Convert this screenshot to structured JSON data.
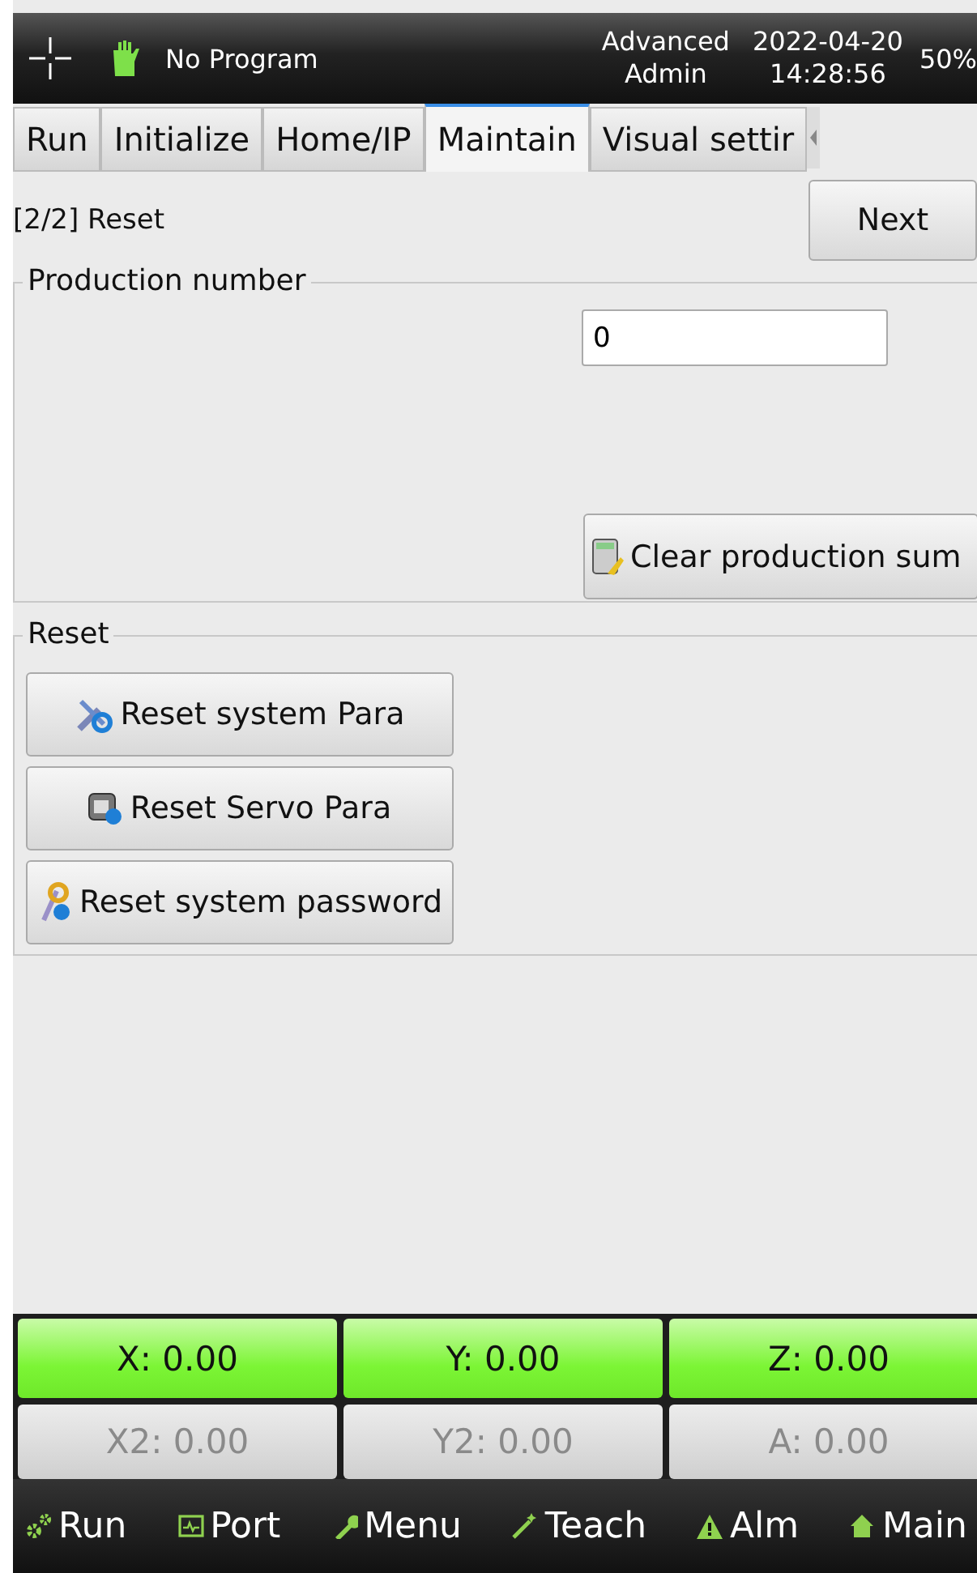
{
  "status_bar": {
    "program": "No Program",
    "user_level": "Advanced",
    "user": "Admin",
    "date": "2022-04-20",
    "time": "14:28:56",
    "speed": "50%"
  },
  "tabs": [
    {
      "label": "Run",
      "selected": false
    },
    {
      "label": "Initialize",
      "selected": false
    },
    {
      "label": "Home/IP",
      "selected": false
    },
    {
      "label": "Maintain",
      "selected": true
    },
    {
      "label": "Visual settir",
      "selected": false
    }
  ],
  "page": {
    "step": "[2/2] Reset",
    "next_button": "Next"
  },
  "production": {
    "title": "Production number",
    "value": "0",
    "clear_button": "Clear production sum"
  },
  "reset": {
    "title": "Reset",
    "buttons": [
      {
        "kind": "tools",
        "label": "Reset system Para"
      },
      {
        "kind": "servo",
        "label": "Reset Servo Para"
      },
      {
        "kind": "key",
        "label": "Reset system password"
      }
    ]
  },
  "axes": [
    {
      "label": "X: 0.00",
      "enabled": true
    },
    {
      "label": "Y: 0.00",
      "enabled": true
    },
    {
      "label": "Z: 0.00",
      "enabled": true
    },
    {
      "label": "X2: 0.00",
      "enabled": false
    },
    {
      "label": "Y2: 0.00",
      "enabled": false
    },
    {
      "label": "A: 0.00",
      "enabled": false
    }
  ],
  "nav": [
    {
      "kind": "gears",
      "label": "Run"
    },
    {
      "kind": "monitor",
      "label": "Port"
    },
    {
      "kind": "wrench",
      "label": "Menu"
    },
    {
      "kind": "wand",
      "label": "Teach"
    },
    {
      "kind": "alarm",
      "label": "Alm"
    },
    {
      "kind": "home",
      "label": "Main"
    }
  ]
}
